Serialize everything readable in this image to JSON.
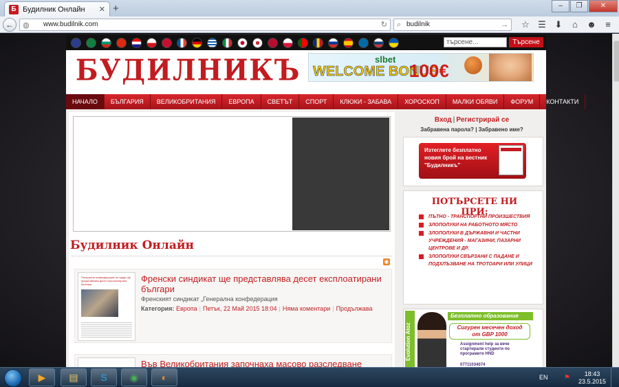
{
  "browser": {
    "tab_title": "Будилник Онлайн",
    "new_tab": "+",
    "url": "www.budilnik.com",
    "search_value": "budilnik"
  },
  "site": {
    "search_placeholder": "търсене...",
    "search_button": "Търсене",
    "logo": "БУДИЛНИКЪ",
    "banner": {
      "brand": "slbet",
      "text": "WELCOME BONUS",
      "amount": "100€"
    },
    "menu": [
      "НАЧАЛО",
      "БЪЛГАРИЯ",
      "ВЕЛИКОБРИТАНИЯ",
      "ЕВРОПА",
      "СВЕТЪТ",
      "СПОРТ",
      "КЛЮКИ - ЗАБАВА",
      "ХОРОСКОП",
      "МАЛКИ ОБЯВИ",
      "ФОРУМ",
      "КОНТАКТИ"
    ],
    "page_title": "Будилник Онлайн"
  },
  "articles": [
    {
      "title": "Френски синдикат ще представлява десет експлоатирани българи",
      "excerpt": "Френският синдикат „Генерална конфедерация",
      "category_label": "Категория:",
      "category": "Европа",
      "date": "Петък, 22 Май 2015 18:04",
      "comments": "Няма коментари",
      "more": "Продължава",
      "thumb_caption": "Генерална конфедерация на труда ще представлява десет експлоатирани българи"
    },
    {
      "title": "Във Великобритания започнаха масово разследване"
    }
  ],
  "sidebar": {
    "login": "Вход",
    "register": "Регистрирай се",
    "forgot_password": "Забравена парола?",
    "forgot_username": "Забравено име?",
    "download_banner": "Изтеглете безплатно новия брой на вестник \"Будилникъ\"",
    "find_us_title": "ПОТЪРСЕТЕ НИ ПРИ:",
    "find_us_items": [
      "ПЪТНО - ТРАНСПОРТНИ ПРОИЗШЕСТВИЯ",
      "ЗЛОПОЛУКИ НА РАБОТНОТО МЯСТО",
      "ЗЛОПОЛУКИ В ДЪРЖАВНИ И ЧАСТНИ УЧРЕЖДЕНИЯ - МАГАЗИНИ, ПАЗАРНИ ЦЕНТРОВЕ И ДР.",
      "ЗЛОПОЛУКИ СВЪРЗАНИ С ПАДАНЕ И ПОДХЛЪЗВАНЕ НА ТРОТОАРИ ИЛИ УЛИЦИ"
    ],
    "edu_vertical": "Evolution Atoz",
    "edu_head": "Безплатно образование",
    "edu_bubble": "Сигурен месечен доход от GBP 1000",
    "edu_sub": "Assignment help за вече стартирали студенти по програмите HND",
    "edu_phone": "07711034074"
  },
  "taskbar": {
    "lang": "EN",
    "time": "18:43",
    "date": "23.5.2015 г."
  },
  "colors": {
    "brand_red": "#c21c20",
    "menu_red": "#c8161d",
    "active_menu": "#6a0a0e"
  }
}
